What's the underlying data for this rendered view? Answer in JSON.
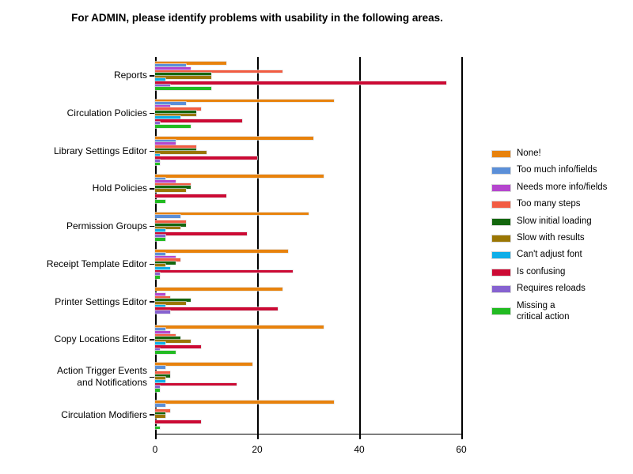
{
  "chart_data": {
    "type": "bar",
    "orientation": "horizontal",
    "title": "For ADMIN, please identify problems with usability in the following areas.",
    "xlabel": "",
    "ylabel": "",
    "xlim": [
      0,
      60
    ],
    "xticks": [
      0,
      20,
      40,
      60
    ],
    "xtick_labels": [
      "0",
      "20",
      "40",
      "60"
    ],
    "grid": "vertical-only",
    "legend_position": "right",
    "categories": [
      "Reports",
      "Circulation Policies",
      "Library Settings Editor",
      "Hold Policies",
      "Permission Groups",
      "Receipt Template Editor",
      "Printer Settings Editor",
      "Copy Locations Editor",
      "Action Trigger Events\nand Notifications",
      "Circulation Modifiers"
    ],
    "series": [
      {
        "name": "None!",
        "color": "#E8820C",
        "values": [
          14,
          35,
          31,
          33,
          30,
          26,
          25,
          33,
          19,
          35
        ]
      },
      {
        "name": "Too much info/fields",
        "color": "#5B8FD8",
        "values": [
          6,
          6,
          4,
          2,
          5,
          2,
          0,
          2,
          2,
          2
        ]
      },
      {
        "name": "Needs more info/fields",
        "color": "#B546CE",
        "values": [
          7,
          3,
          4,
          4,
          0,
          4,
          2,
          3,
          0,
          0
        ]
      },
      {
        "name": "Too many steps",
        "color": "#F25C42",
        "values": [
          25,
          9,
          8,
          7,
          6,
          5,
          3,
          4,
          3,
          3
        ]
      },
      {
        "name": "Slow initial loading",
        "color": "#13660D",
        "values": [
          11,
          8,
          8,
          7,
          6,
          4,
          7,
          5,
          3,
          2
        ]
      },
      {
        "name": "Slow with results",
        "color": "#9A7603",
        "values": [
          11,
          8,
          10,
          6,
          5,
          2,
          6,
          7,
          2,
          2
        ]
      },
      {
        "name": "Can't adjust font",
        "color": "#0FAEE8",
        "values": [
          2,
          5,
          1,
          0,
          2,
          3,
          2,
          2,
          2,
          0
        ]
      },
      {
        "name": "Is confusing",
        "color": "#CC0A34",
        "values": [
          57,
          17,
          20,
          14,
          18,
          27,
          24,
          9,
          16,
          9
        ]
      },
      {
        "name": "Requires reloads",
        "color": "#8662D0",
        "values": [
          3,
          1,
          1,
          0,
          2,
          1,
          3,
          1,
          1,
          0
        ]
      },
      {
        "name": "Missing a\ncritical action",
        "color": "#22BB22",
        "values": [
          11,
          7,
          1,
          2,
          2,
          1,
          0,
          4,
          1,
          1
        ]
      }
    ]
  }
}
